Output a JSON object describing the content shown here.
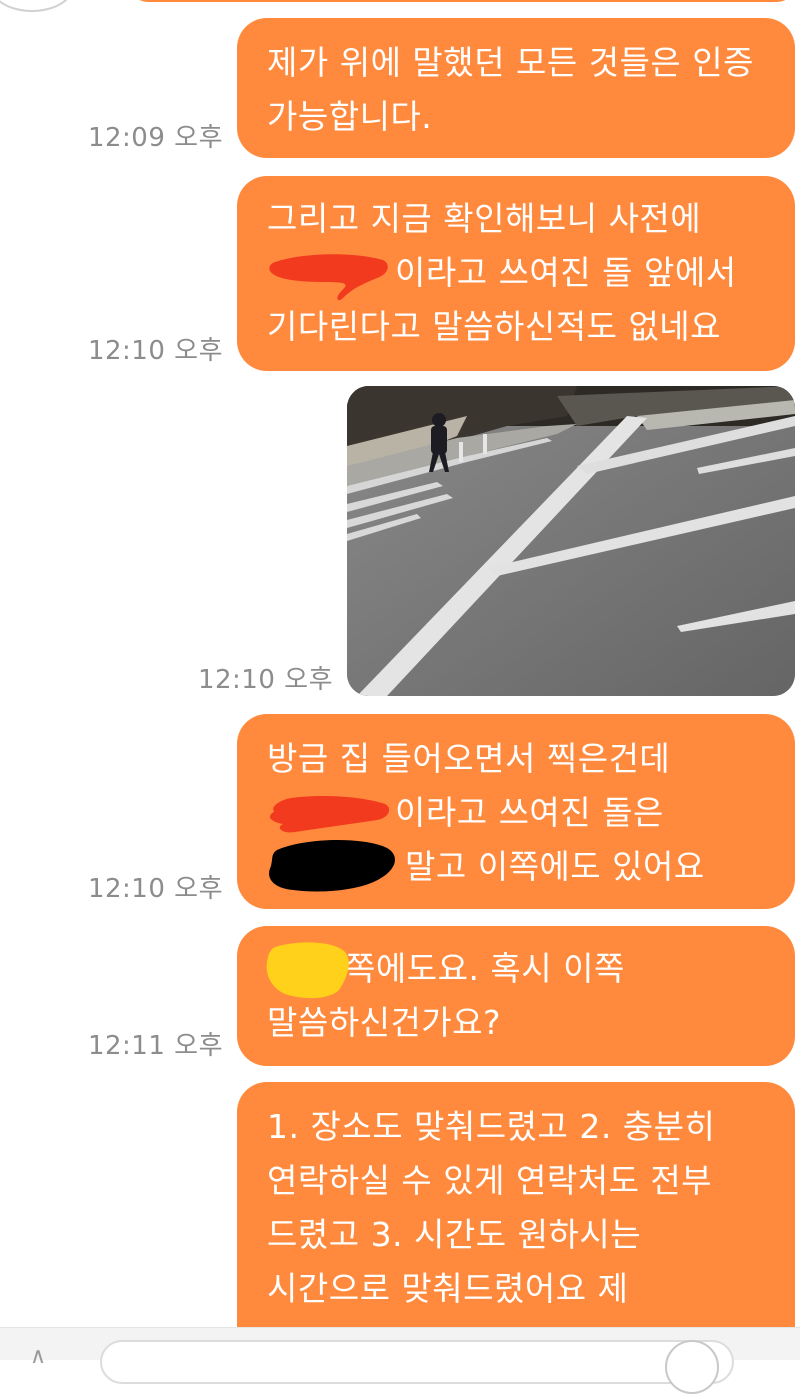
{
  "colors": {
    "bubble": "#ff8a3d",
    "bubble_text": "#ffffff",
    "timestamp": "#8c8c8c",
    "background": "#ffffff",
    "redaction_red": "#f23a1e",
    "redaction_black": "#000000",
    "redaction_yellow": "#ffd11a"
  },
  "messages": [
    {
      "time": "12:09 오후",
      "lines": [
        "제가 위에 말했던 모든 것들은 인증",
        "가능합니다."
      ]
    },
    {
      "time": "12:10 오후",
      "lines": [
        "그리고 지금 확인해보니 사전에",
        "이라고 쓰여진 돌 앞에서",
        "기다린다고 말씀하신적도 없네요"
      ]
    },
    {
      "time": "12:10 오후",
      "image": "street-crosswalk-photo"
    },
    {
      "time": "12:10 오후",
      "lines": [
        "방금 집 들어오면서 찍은건데",
        "이라고 쓰여진 돌은",
        "말고 이쪽에도 있어요"
      ]
    },
    {
      "time": "12:11 오후",
      "lines": [
        "쪽에도요. 혹시 이쪽",
        "말씀하신건가요?"
      ]
    },
    {
      "lines": [
        "1. 장소도 맞춰드렸고 2. 충분히",
        "연락하실 수 있게 연락처도 전부",
        "드렸고 3. 시간도 원하시는",
        "시간으로 맞춰드렸어요 제"
      ]
    }
  ],
  "input_bar": {
    "attach_icon": "chevron-icon",
    "send_icon": "circle-icon"
  }
}
